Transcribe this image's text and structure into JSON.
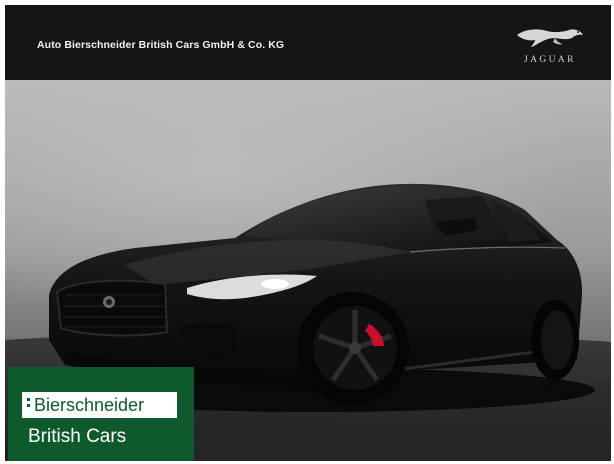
{
  "header": {
    "dealer_name": "Auto Bierschneider British Cars GmbH & Co. KG",
    "brand_logo_text": "JAGUAR",
    "brand_icon": "leaping-jaguar-icon"
  },
  "photo": {
    "subject": "car-photo",
    "car_color": "#111111",
    "caliper_color": "#c8102e"
  },
  "badge": {
    "line1": "Bierschneider",
    "line2": "British Cars",
    "background": "#0e5a2c"
  },
  "colors": {
    "header_bg": "#151515",
    "header_text": "#f2f2f2"
  }
}
